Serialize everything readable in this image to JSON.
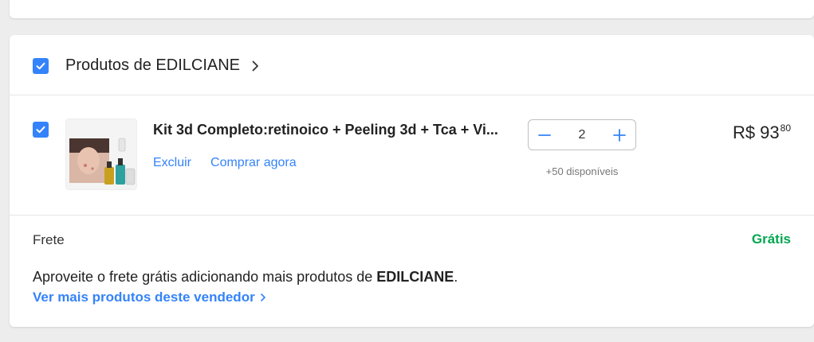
{
  "seller": {
    "title_prefix": "Produtos de",
    "name": "EDILCIANE"
  },
  "item": {
    "title": "Kit 3d Completo:retinoico + Peeling 3d + Tca + Vi...",
    "delete_label": "Excluir",
    "buy_now_label": "Comprar agora",
    "quantity": "2",
    "available": "+50 disponíveis",
    "price_currency": "R$",
    "price_int": "93",
    "price_cents": "80"
  },
  "shipping": {
    "label": "Frete",
    "value": "Grátis",
    "promo_text": "Aproveite o frete grátis adicionando mais produtos de",
    "promo_seller": "EDILCIANE",
    "promo_end": ".",
    "link_label": "Ver mais produtos deste vendedor"
  },
  "colors": {
    "accent": "#3483fa",
    "free": "#00a650"
  }
}
